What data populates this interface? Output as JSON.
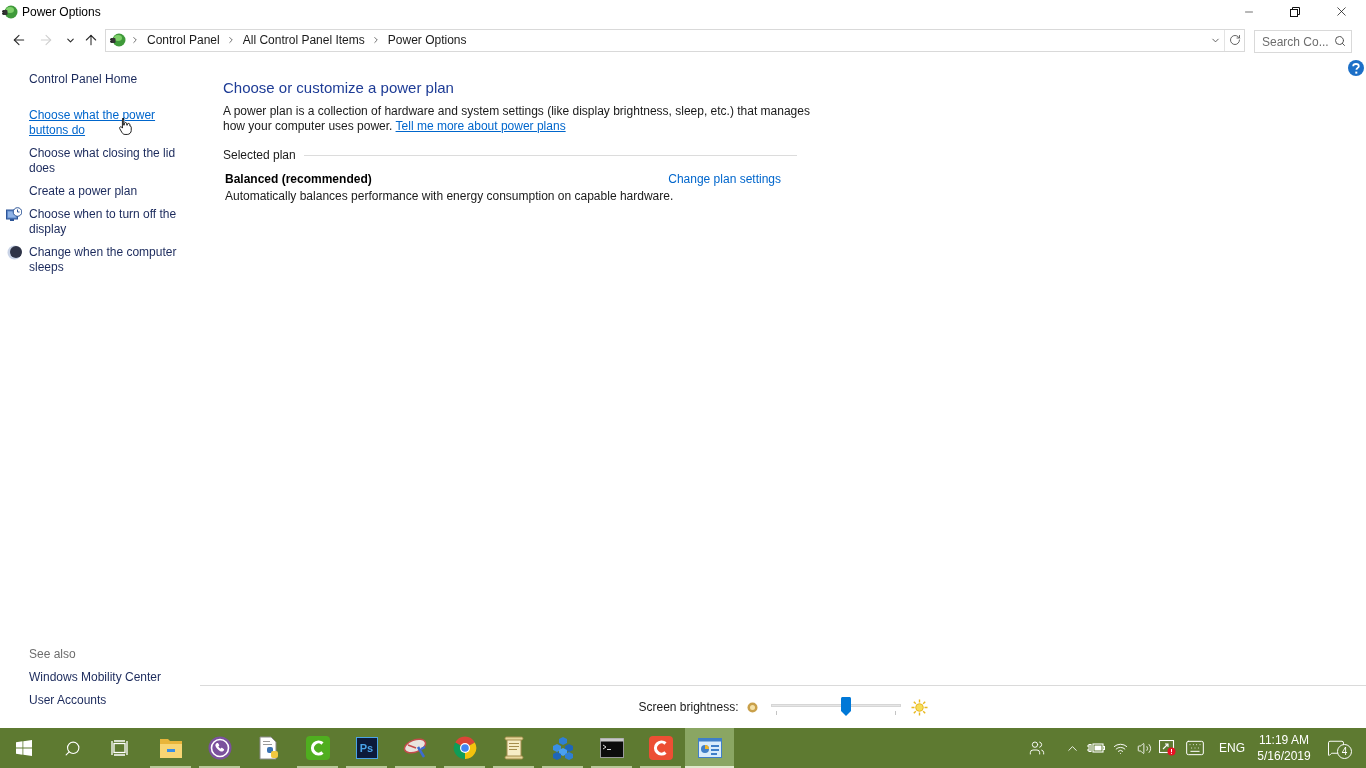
{
  "window": {
    "title": "Power Options"
  },
  "navigation": [
    {
      "kind": "back",
      "disabled": false
    },
    {
      "kind": "forward",
      "disabled": true
    },
    {
      "kind": "recent",
      "disabled": false
    },
    {
      "kind": "up",
      "disabled": false
    }
  ],
  "address_bar": {
    "breadcrumbs": [
      "Control Panel",
      "All Control Panel Items",
      "Power Options"
    ]
  },
  "search": {
    "placeholder": "Search Co..."
  },
  "sidebar": {
    "home": "Control Panel Home",
    "tasks": [
      {
        "label": "Choose what the power buttons do",
        "kind": "plain",
        "hovered": true
      },
      {
        "label": "Choose what closing the lid does",
        "kind": "plain",
        "hovered": false
      },
      {
        "label": "Create a power plan",
        "kind": "plain",
        "hovered": false
      },
      {
        "label": "Choose when to turn off the display",
        "kind": "display",
        "hovered": false
      },
      {
        "label": "Change when the computer sleeps",
        "kind": "sleep",
        "hovered": false
      }
    ],
    "see_also": {
      "heading": "See also",
      "links": [
        "Windows Mobility Center",
        "User Accounts"
      ]
    }
  },
  "main": {
    "heading": "Choose or customize a power plan",
    "intro": "A power plan is a collection of hardware and system settings (like display brightness, sleep, etc.) that manages how your computer uses power.",
    "intro_link": "Tell me more about power plans",
    "selected_plan": {
      "label": "Selected plan",
      "name": "Balanced (recommended)",
      "settings_link": "Change plan settings",
      "description": "Automatically balances performance with energy consumption on capable hardware."
    }
  },
  "brightness": {
    "label": "Screen brightness:",
    "level": 0.59
  },
  "taskbar": {
    "apps": [
      {
        "kind": "explorer",
        "running": true,
        "active": false
      },
      {
        "kind": "viber",
        "running": true,
        "active": false
      },
      {
        "kind": "python",
        "running": false,
        "active": false
      },
      {
        "kind": "camtasia",
        "running": true,
        "active": false
      },
      {
        "kind": "photoshop",
        "label": "Ps",
        "running": true,
        "active": false
      },
      {
        "kind": "satellite",
        "running": true,
        "active": false
      },
      {
        "kind": "chrome",
        "running": true,
        "active": false
      },
      {
        "kind": "notepad",
        "running": true,
        "active": false
      },
      {
        "kind": "cubes",
        "running": true,
        "active": false
      },
      {
        "kind": "terminal",
        "running": true,
        "active": false
      },
      {
        "kind": "recorder",
        "running": true,
        "active": false
      },
      {
        "kind": "control_panel",
        "running": true,
        "active": true
      }
    ],
    "tray": {
      "language": "ENG",
      "time": "11:19 AM",
      "date": "5/16/2019",
      "notification_count": "4"
    }
  }
}
